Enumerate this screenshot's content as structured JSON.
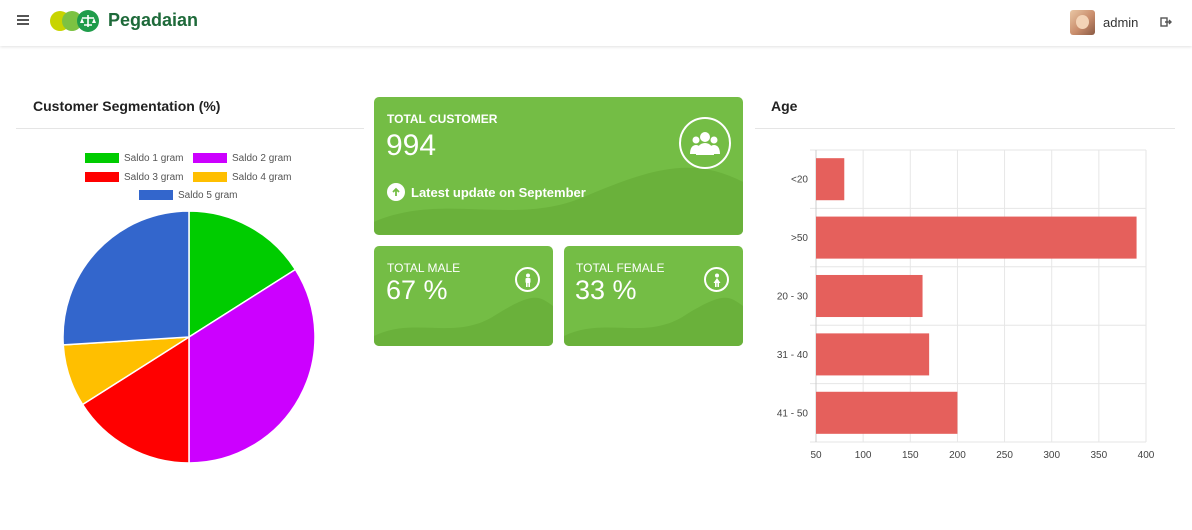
{
  "header": {
    "brand": "Pegadaian",
    "username": "admin"
  },
  "segmentation": {
    "title": "Customer Segmentation (%)",
    "legend": [
      {
        "label": "Saldo 1 gram",
        "color": "#00cc00"
      },
      {
        "label": "Saldo 2 gram",
        "color": "#cc00ff"
      },
      {
        "label": "Saldo 3 gram",
        "color": "#ff0000"
      },
      {
        "label": "Saldo 4 gram",
        "color": "#ffbf00"
      },
      {
        "label": "Saldo 5 gram",
        "color": "#3366cc"
      }
    ]
  },
  "cards": {
    "total_customer": {
      "label": "TOTAL CUSTOMER",
      "value": "994",
      "update": "Latest update on September"
    },
    "total_male": {
      "label": "TOTAL MALE",
      "value": "67 %"
    },
    "total_female": {
      "label": "TOTAL FEMALE",
      "value": "33 %"
    }
  },
  "age": {
    "title": "Age"
  },
  "chart_data": [
    {
      "type": "pie",
      "title": "Customer Segmentation (%)",
      "categories": [
        "Saldo 1 gram",
        "Saldo 2 gram",
        "Saldo 3 gram",
        "Saldo 4 gram",
        "Saldo 5 gram"
      ],
      "values": [
        16,
        34,
        16,
        8,
        26
      ],
      "colors": [
        "#00cc00",
        "#cc00ff",
        "#ff0000",
        "#ffbf00",
        "#3366cc"
      ],
      "legend": "top"
    },
    {
      "type": "bar",
      "orientation": "horizontal",
      "title": "Age",
      "categories": [
        "<20",
        ">50",
        "20 - 30",
        "31 - 40",
        "41 - 50"
      ],
      "values": [
        80,
        390,
        163,
        170,
        200
      ],
      "xlim": [
        50,
        400
      ],
      "xticks": [
        50,
        100,
        150,
        200,
        250,
        300,
        350,
        400
      ],
      "color": "#e5605c",
      "grid": true
    }
  ]
}
